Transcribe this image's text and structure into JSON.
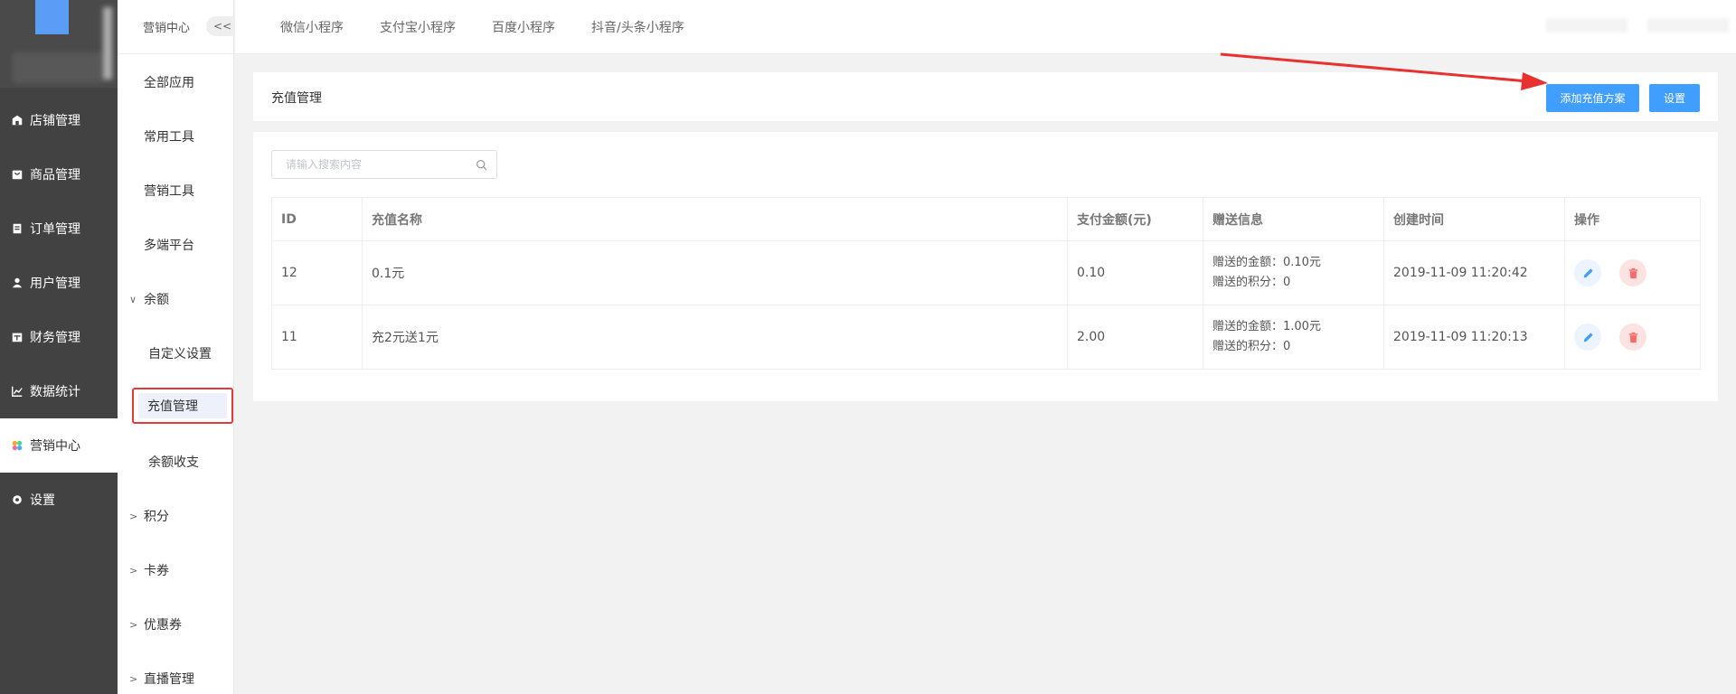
{
  "sidebar": {
    "items": [
      {
        "label": "店铺管理",
        "icon": "store-icon"
      },
      {
        "label": "商品管理",
        "icon": "goods-icon"
      },
      {
        "label": "订单管理",
        "icon": "order-icon"
      },
      {
        "label": "用户管理",
        "icon": "user-icon"
      },
      {
        "label": "财务管理",
        "icon": "finance-icon"
      },
      {
        "label": "数据统计",
        "icon": "chart-icon"
      },
      {
        "label": "营销中心",
        "icon": "marketing-icon",
        "active": true
      },
      {
        "label": "设置",
        "icon": "gear-icon"
      }
    ]
  },
  "subnav": {
    "title": "营销中心",
    "collapse_label": "<<",
    "items": {
      "all_apps": "全部应用",
      "common_tools": "常用工具",
      "marketing_tools": "营销工具",
      "multi_platform": "多端平台",
      "balance": "余额",
      "custom_settings": "自定义设置",
      "recharge_management": "充值管理",
      "balance_flow": "余额收支",
      "points": "积分",
      "cards": "卡券",
      "coupons": "优惠券",
      "live": "直播管理"
    }
  },
  "top_tabs": {
    "wechat": "微信小程序",
    "alipay": "支付宝小程序",
    "baidu": "百度小程序",
    "douyin": "抖音/头条小程序"
  },
  "header": {
    "title": "充值管理",
    "add_button": "添加充值方案",
    "settings_button": "设置"
  },
  "search": {
    "placeholder": "请输入搜索内容",
    "value": ""
  },
  "table": {
    "headers": {
      "id": "ID",
      "name": "充值名称",
      "amount": "支付金额(元)",
      "gift": "赠送信息",
      "created": "创建时间",
      "ops": "操作"
    },
    "rows": [
      {
        "id": "12",
        "name": "0.1元",
        "amount": "0.10",
        "gift_amount": "赠送的金额：0.10元",
        "gift_points": "赠送的积分：0",
        "created": "2019-11-09 11:20:42"
      },
      {
        "id": "11",
        "name": "充2元送1元",
        "amount": "2.00",
        "gift_amount": "赠送的金额：1.00元",
        "gift_points": "赠送的积分：0",
        "created": "2019-11-09 11:20:13"
      }
    ]
  },
  "colors": {
    "sidebar_bg": "#424242",
    "primary": "#409eff",
    "danger": "#f56c6c",
    "highlight_border": "#e4393c",
    "arrow": "#e8322f"
  }
}
